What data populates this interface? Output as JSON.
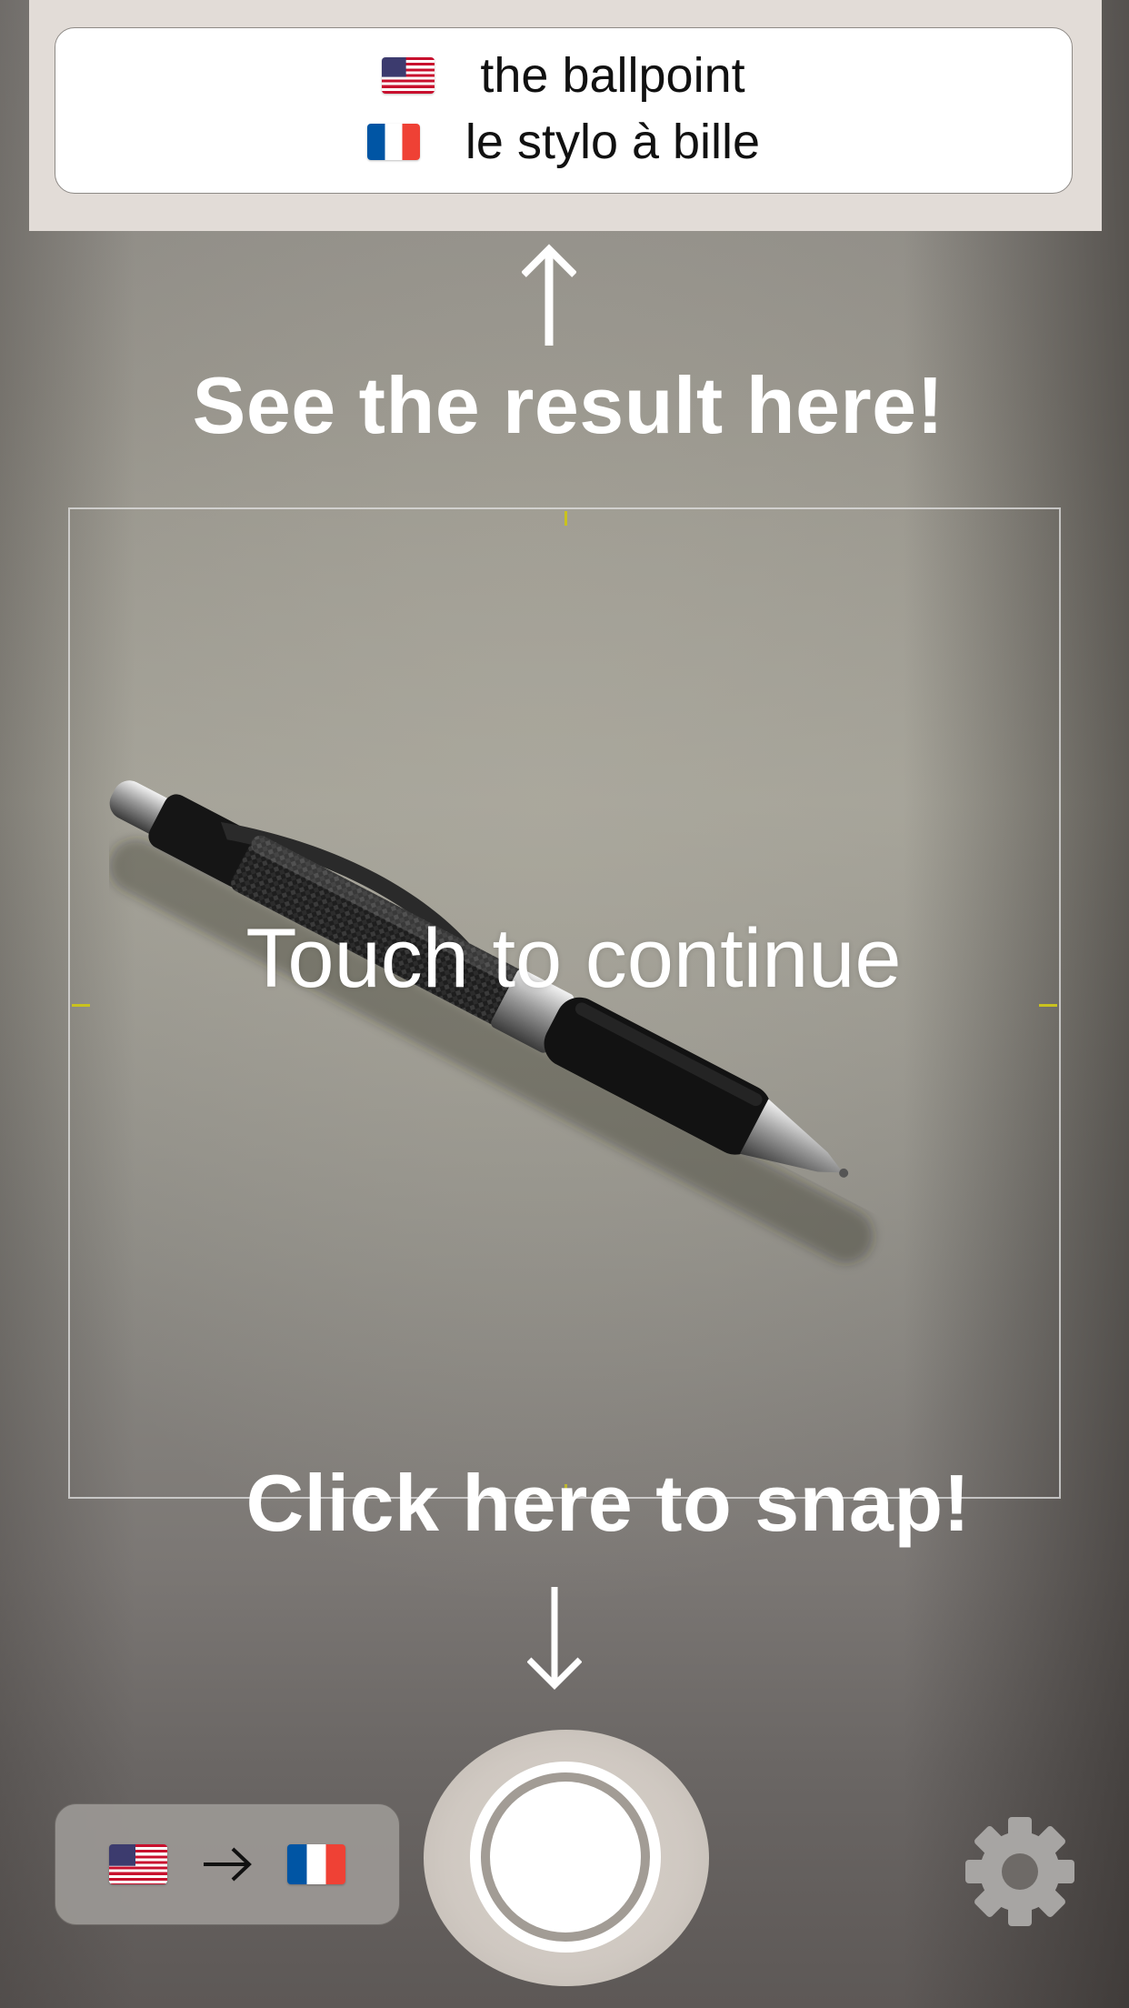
{
  "result": {
    "source_flag": "us-flag-icon",
    "source_text": "the ballpoint",
    "target_flag": "fr-flag-icon",
    "target_text": "le stylo à bille"
  },
  "hints": {
    "result_hint": "See the result here!",
    "snap_hint": "Click here to snap!",
    "touch_hint": "Touch to continue"
  },
  "language_selector": {
    "from_flag": "us-flag-icon",
    "arrow": "right-arrow-icon",
    "to_flag": "fr-flag-icon"
  },
  "controls": {
    "shutter": "shutter-button",
    "settings": "gear-icon"
  },
  "colors": {
    "accent_tick": "#c9c21e",
    "hint_text": "#ffffff",
    "result_card": "#ffffff"
  }
}
